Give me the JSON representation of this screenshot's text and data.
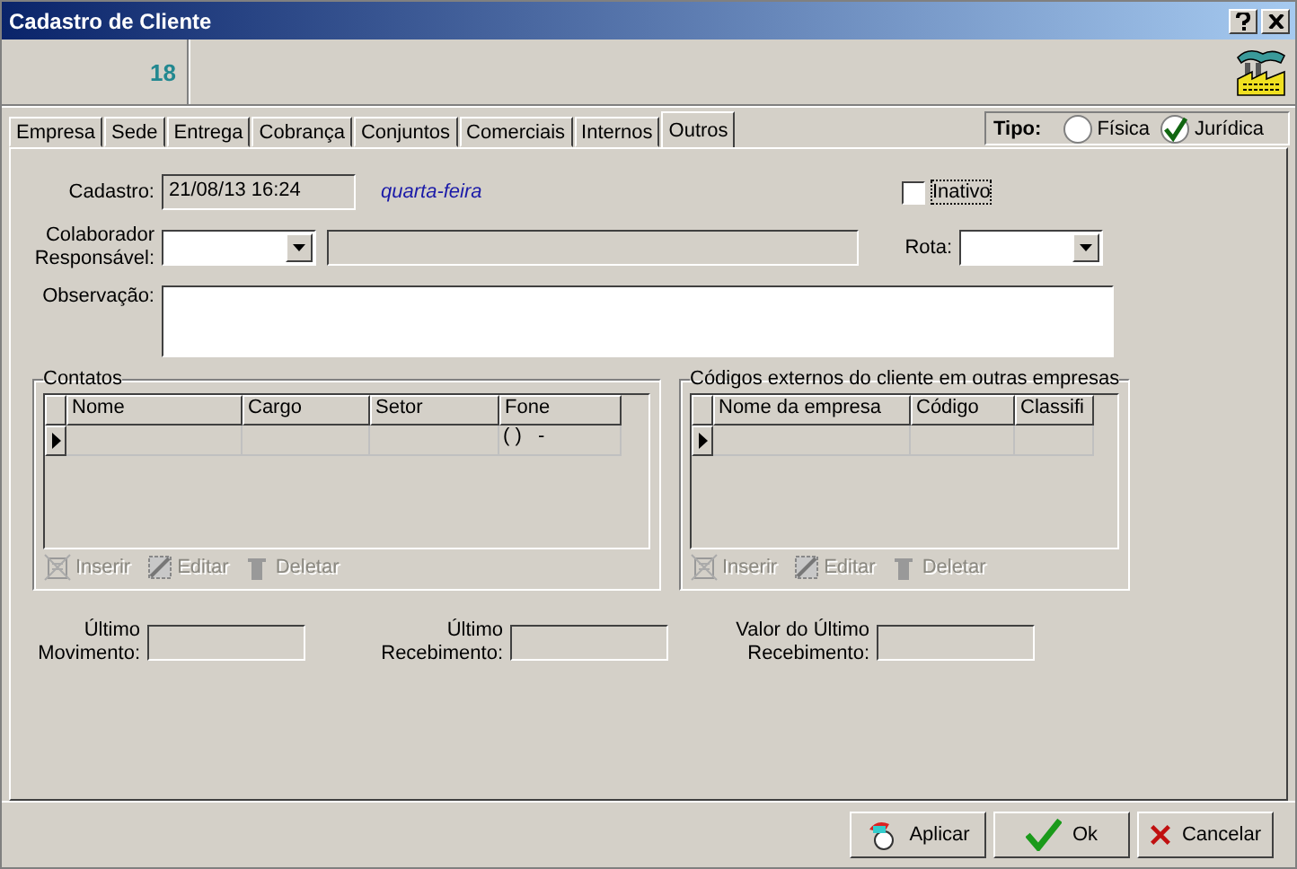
{
  "window": {
    "title": "Cadastro de Cliente"
  },
  "header": {
    "record_number": "18"
  },
  "tabs": [
    {
      "label": "Empresa",
      "selected": false
    },
    {
      "label": "Sede",
      "selected": false
    },
    {
      "label": "Entrega",
      "selected": false
    },
    {
      "label": "Cobrança",
      "selected": false
    },
    {
      "label": "Conjuntos",
      "selected": false
    },
    {
      "label": "Comerciais",
      "selected": false
    },
    {
      "label": "Internos",
      "selected": false
    },
    {
      "label": "Outros",
      "selected": true
    }
  ],
  "tipo": {
    "label": "Tipo:",
    "options": [
      {
        "label": "Física",
        "selected": false
      },
      {
        "label": "Jurídica",
        "selected": true
      }
    ]
  },
  "form": {
    "cadastro": {
      "label": "Cadastro:",
      "value": "21/08/13 16:24",
      "weekday": "quarta-feira"
    },
    "inativo": {
      "label": "Inativo",
      "checked": false
    },
    "colaborador": {
      "label": [
        "Colaborador",
        "Responsável:"
      ]
    },
    "rota": {
      "label": "Rota:"
    },
    "observacao": {
      "label": "Observação:"
    }
  },
  "groups": [
    {
      "title": "Contatos",
      "columns": [
        "Nome",
        "Cargo",
        "Setor",
        "Fone"
      ],
      "rows": [
        {
          "current": true,
          "cells": [
            "",
            "",
            "",
            "( )   -"
          ]
        }
      ],
      "buttons": [
        {
          "label": "Inserir",
          "kind": "insert",
          "disabled": true
        },
        {
          "label": "Editar",
          "kind": "edit",
          "disabled": true
        },
        {
          "label": "Deletar",
          "kind": "delete",
          "disabled": true
        }
      ]
    },
    {
      "title": "Códigos externos do cliente em outras empresas",
      "columns": [
        "Nome da empresa",
        "Código",
        "Classifi"
      ],
      "rows": [
        {
          "current": true,
          "cells": [
            "",
            "",
            ""
          ]
        }
      ],
      "buttons": [
        {
          "label": "Inserir",
          "kind": "insert",
          "disabled": true
        },
        {
          "label": "Editar",
          "kind": "edit",
          "disabled": true
        },
        {
          "label": "Deletar",
          "kind": "delete",
          "disabled": true
        }
      ]
    }
  ],
  "totals": [
    {
      "label": [
        "Último",
        "Movimento:"
      ]
    },
    {
      "label": [
        "Último",
        "Recebimento:"
      ]
    },
    {
      "label": [
        "Valor do Último",
        "Recebimento:"
      ]
    }
  ],
  "buttons": [
    {
      "label": "Aplicar",
      "kind": "apply"
    },
    {
      "label": "Ok",
      "kind": "ok"
    },
    {
      "label": "Cancelar",
      "kind": "cancel"
    }
  ]
}
